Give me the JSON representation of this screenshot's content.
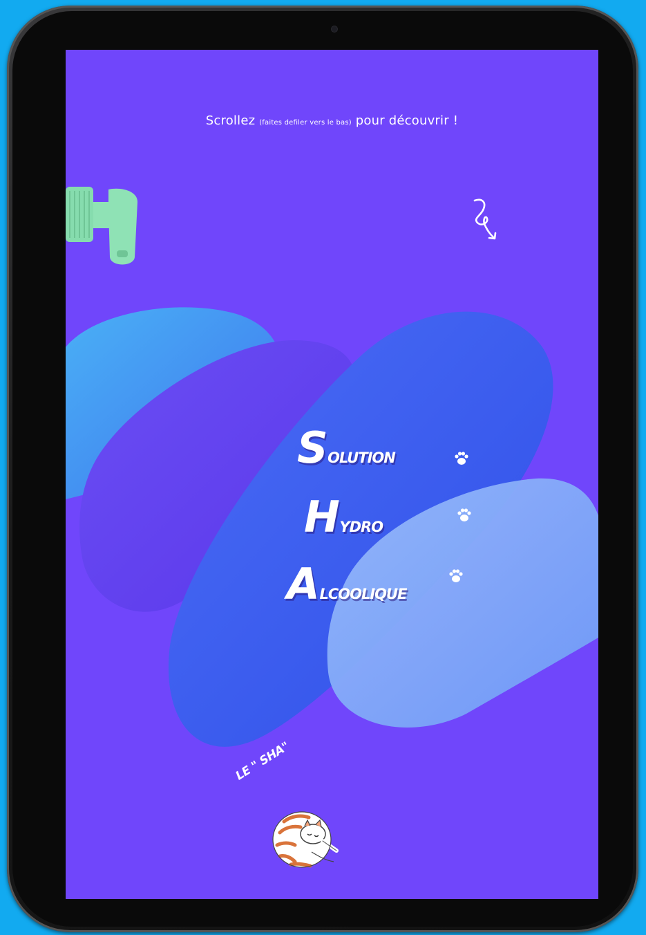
{
  "screen": {
    "background_color": "#7046fb",
    "scroll_hint": {
      "part1": "Scrollez",
      "part2": "(faites defiler vers le bas)",
      "part3": "pour découvrir !"
    },
    "acronym": [
      {
        "initial": "S",
        "rest": "OLUTION"
      },
      {
        "initial": "H",
        "rest": "YDRO"
      },
      {
        "initial": "A",
        "rest": "LCOOLIQUE"
      }
    ],
    "sha_label": "LE \" SHA\"",
    "icons": {
      "arrow": "curly-arrow-icon",
      "sanitizer": "sanitizer-bottle-icon",
      "paw": "paw-icon",
      "cat": "sleeping-cat-icon"
    }
  },
  "colors": {
    "page_bg": "#12aaf0",
    "screen_bg": "#7046fb",
    "sanitizer": "#8fe2b5",
    "text": "#ffffff"
  }
}
